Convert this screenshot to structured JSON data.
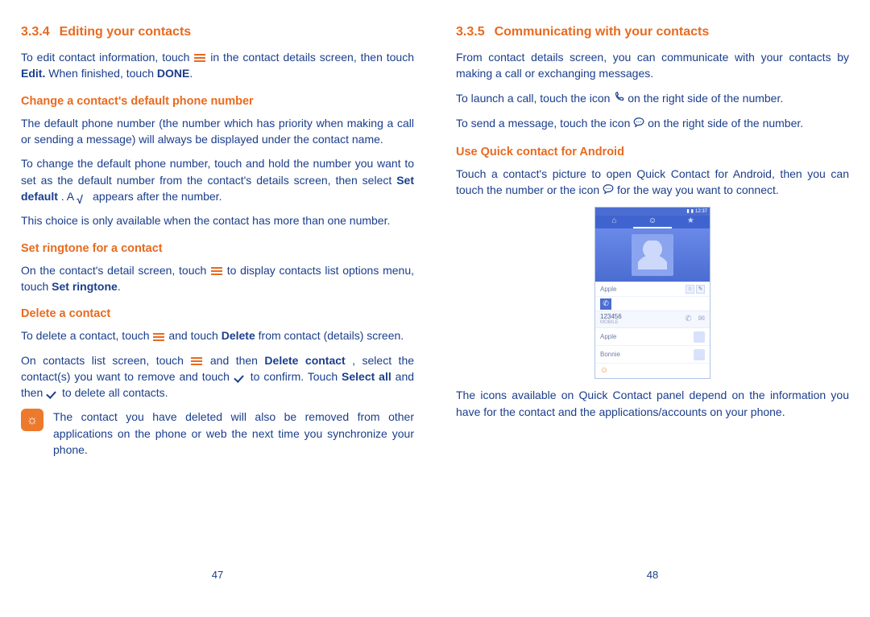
{
  "left": {
    "section_num": "3.3.4",
    "section_title": "Editing your contacts",
    "p1_a": "To edit contact information, touch ",
    "p1_b": " in the contact details screen, then touch ",
    "p1_edit": "Edit.",
    "p1_c": " When finished, touch ",
    "p1_done": "DONE",
    "p1_d": ".",
    "sub1": "Change a contact's default phone number",
    "p2": "The default phone number (the number which has priority when making a call or sending a message) will always be displayed under the contact name.",
    "p3_a": "To change the default phone number, touch and hold the number you want to set as the default number from the contact's details screen, then select ",
    "p3_set": "Set default",
    "p3_b": ". A ",
    "p3_c": " appears after the number.",
    "p4": "This choice is only available when the contact has more than one number.",
    "sub2": "Set ringtone for a contact",
    "p5_a": "On the contact's detail screen, touch ",
    "p5_b": " to display contacts list options menu, touch ",
    "p5_ring": "Set ringtone",
    "p5_c": ".",
    "sub3": "Delete a contact",
    "p6_a": "To delete a contact, touch ",
    "p6_b": " and touch ",
    "p6_del": "Delete",
    "p6_c": " from contact (details) screen.",
    "p7_a": "On contacts list screen, touch ",
    "p7_b": " and then ",
    "p7_delc": "Delete contact",
    "p7_c": ", select the contact(s) you want to remove and touch ",
    "p7_d": " to confirm. Touch ",
    "p7_sel": "Select all",
    "p7_e": " and then ",
    "p7_f": " to delete all contacts.",
    "tip_icon": "☼",
    "tip": "The contact you have deleted will also be removed from other applications on the phone or web the next time you synchronize your phone.",
    "page_num": "47"
  },
  "right": {
    "section_num": "3.3.5",
    "section_title": "Communicating with your contacts",
    "p1": "From contact details screen, you can communicate with your contacts by making a call or exchanging messages.",
    "p2_a": "To launch a call, touch the icon ",
    "p2_b": " on the right side of the number.",
    "p3_a": "To send a message, touch the icon ",
    "p3_b": " on the right side of the number.",
    "sub1": "Use Quick contact for Android",
    "p4_a": "Touch a contact's picture to open Quick Contact for Android, then you can touch the number or the icon ",
    "p4_b": " for the way you want to connect.",
    "p5": "The icons available on Quick Contact panel depend on the information you have for the contact and the applications/accounts on your phone.",
    "page_num": "48",
    "phone": {
      "time": "12:37",
      "name": "Apple",
      "number": "123456",
      "mobile": "MOBILE",
      "item1": "Apple",
      "item2": "Bonnie"
    }
  }
}
